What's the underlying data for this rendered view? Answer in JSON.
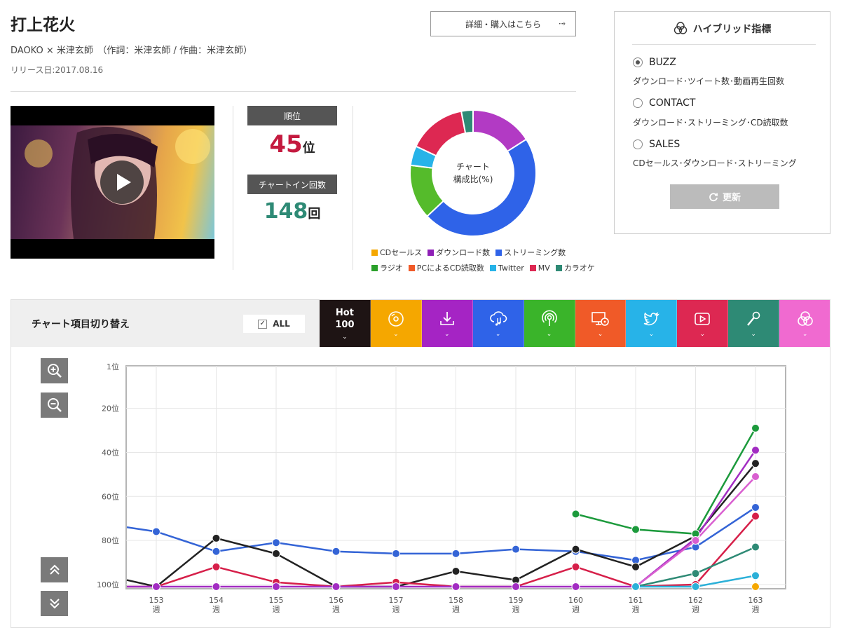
{
  "song": {
    "title": "打上花火",
    "artist_line": "DAOKO × 米津玄師　（作詞：米津玄師 / 作曲：米津玄師）",
    "release": "リリース日:2017.08.16",
    "buy_label": "詳細・購入はこちら"
  },
  "stats": {
    "rank_label": "順位",
    "rank_value": "45",
    "rank_unit": "位",
    "count_label": "チャートイン回数",
    "count_value": "148",
    "count_unit": "回"
  },
  "donut": {
    "center_line1": "チャート",
    "center_line2": "構成比(%)",
    "slices": [
      {
        "name": "ダウンロード数",
        "value": 16,
        "color": "#b23ac4"
      },
      {
        "name": "ストリーミング数",
        "value": 47,
        "color": "#2f63e8"
      },
      {
        "name": "ラジオ",
        "value": 14,
        "color": "#55bb2b"
      },
      {
        "name": "Twitter",
        "value": 5,
        "color": "#27b3e8"
      },
      {
        "name": "MV",
        "value": 15,
        "color": "#dd2852"
      },
      {
        "name": "カラオケ",
        "value": 3,
        "color": "#2e8a75"
      }
    ],
    "legend": [
      {
        "label": "CDセールス",
        "color": "#f5a700"
      },
      {
        "label": "ダウンロード数",
        "color": "#8e1fb6"
      },
      {
        "label": "ストリーミング数",
        "color": "#2f63e8"
      },
      {
        "label": "ラジオ",
        "color": "#2aa02a"
      },
      {
        "label": "PCによるCD読取数",
        "color": "#f05a28"
      },
      {
        "label": "Twitter",
        "color": "#27b3e8"
      },
      {
        "label": "MV",
        "color": "#dd2852"
      },
      {
        "label": "カラオケ",
        "color": "#2e8a75"
      }
    ]
  },
  "hybrid": {
    "title": "ハイブリッド指標",
    "options": [
      {
        "label": "BUZZ",
        "desc": "ダウンロード･ツイート数･動画再生回数",
        "selected": true
      },
      {
        "label": "CONTACT",
        "desc": "ダウンロード･ストリーミング･CD読取数",
        "selected": false
      },
      {
        "label": "SALES",
        "desc": "CDセールス･ダウンロード･ストリーミング",
        "selected": false
      }
    ],
    "refresh_label": "更新"
  },
  "switcher": {
    "label": "チャート項目切り替え",
    "all_label": "ALL",
    "tabs": [
      {
        "name": "hot100",
        "text": "Hot\n100",
        "color": "#1e1414",
        "icon": "hot100-text"
      },
      {
        "name": "cd-sales",
        "color": "#f5a700",
        "icon": "disc-icon"
      },
      {
        "name": "download",
        "color": "#a524c4",
        "icon": "download-icon"
      },
      {
        "name": "streaming",
        "color": "#2f63e8",
        "icon": "cloud-music-icon"
      },
      {
        "name": "radio",
        "color": "#3ab42a",
        "icon": "radio-icon"
      },
      {
        "name": "pc-cd-read",
        "color": "#f05a28",
        "icon": "pc-disc-icon"
      },
      {
        "name": "twitter",
        "color": "#27b3e8",
        "icon": "twitter-icon"
      },
      {
        "name": "mv",
        "color": "#dd2852",
        "icon": "play-icon"
      },
      {
        "name": "karaoke",
        "color": "#2e8a75",
        "icon": "mic-icon"
      },
      {
        "name": "hybrid",
        "color": "#f06ad0",
        "icon": "hybrid-icon"
      }
    ]
  },
  "chart_data": {
    "type": "line",
    "x": [
      "153\n週",
      "154\n週",
      "155\n週",
      "156\n週",
      "157\n週",
      "158\n週",
      "159\n週",
      "160\n週",
      "161\n週",
      "162\n週",
      "163\n週"
    ],
    "y_ticks": [
      "1位",
      "20位",
      "40位",
      "60位",
      "80位",
      "100位"
    ],
    "y_values": [
      1,
      20,
      40,
      60,
      80,
      100
    ],
    "ylim": [
      1,
      100
    ],
    "y_inverted": true,
    "grid": true,
    "series": [
      {
        "key": "streaming",
        "color": "#3464d6",
        "values": [
          76,
          85,
          81,
          85,
          86,
          86,
          84,
          85,
          89,
          83,
          65
        ],
        "lead_in": 74
      },
      {
        "key": "hot100",
        "color": "#222222",
        "values": [
          101,
          79,
          86,
          101,
          101,
          94,
          98,
          84,
          92,
          78,
          45
        ],
        "lead_in": 98
      },
      {
        "key": "mv",
        "color": "#d61f49",
        "values": [
          101,
          92,
          99,
          101,
          99,
          101,
          101,
          92,
          101,
          100,
          69
        ],
        "lead_in": 101
      },
      {
        "key": "download",
        "color": "#a22cc2",
        "values": [
          101,
          101,
          101,
          101,
          101,
          101,
          101,
          101,
          101,
          79,
          39
        ],
        "lead_in": 101
      },
      {
        "key": "radio",
        "color": "#1c9a3c",
        "values": [
          null,
          null,
          null,
          null,
          null,
          null,
          null,
          68,
          75,
          77,
          29
        ]
      },
      {
        "key": "hybrid",
        "color": "#d95fd0",
        "values": [
          null,
          null,
          null,
          null,
          null,
          null,
          null,
          null,
          101,
          80,
          51
        ]
      },
      {
        "key": "karaoke",
        "color": "#2e8a75",
        "values": [
          null,
          null,
          null,
          null,
          null,
          null,
          null,
          null,
          101,
          95,
          83
        ]
      },
      {
        "key": "twitter",
        "color": "#2bb0d8",
        "values": [
          null,
          null,
          null,
          null,
          null,
          null,
          null,
          null,
          101,
          101,
          96
        ]
      },
      {
        "key": "cd-sales",
        "color": "#f5a700",
        "values": [
          null,
          null,
          null,
          null,
          null,
          null,
          null,
          null,
          null,
          null,
          101
        ]
      }
    ]
  }
}
